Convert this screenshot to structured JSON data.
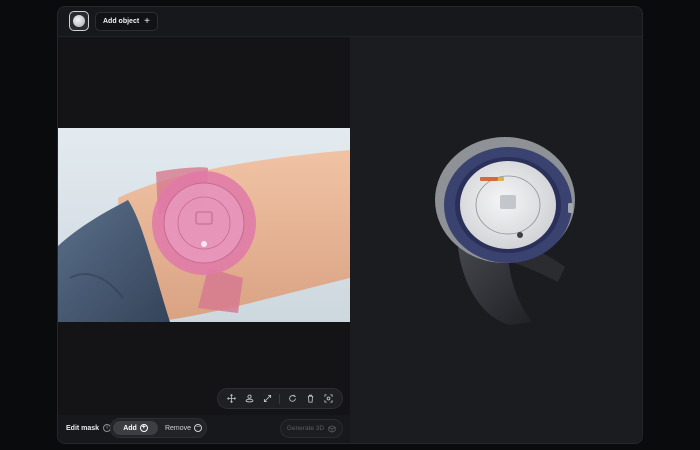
{
  "topbar": {
    "add_object_label": "Add object",
    "add_object_icon": "plus-icon"
  },
  "edit": {
    "label": "Edit mask",
    "mode_add_label": "Add",
    "mode_remove_label": "Remove",
    "selected_mode": "Add",
    "generate_label": "Generate 3D"
  },
  "toolbar": {
    "tools": [
      "move-icon",
      "turntable-icon",
      "expand-icon",
      "rotate-icon",
      "trash-icon",
      "focus-icon"
    ]
  },
  "colors": {
    "mask_overlay": "#e07aa8",
    "watch_bezel": "#3a4270",
    "watch_face": "#e9eaec",
    "skin": "#e9b99a",
    "sleeve": "#4a5e78"
  }
}
